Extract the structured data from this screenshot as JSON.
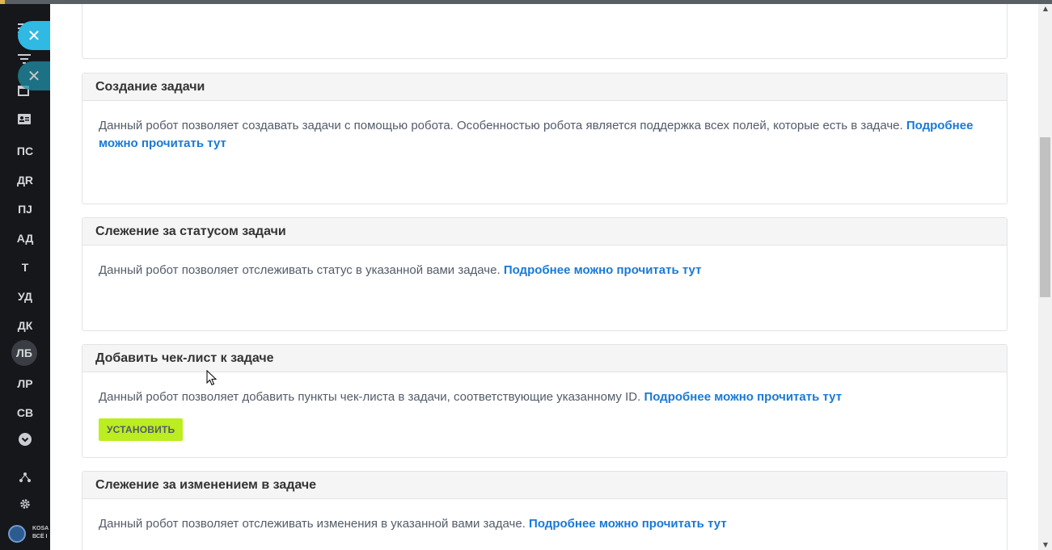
{
  "sidebar": {
    "close_icon": "✕",
    "items": [
      {
        "label": "ПС"
      },
      {
        "label": "ДR"
      },
      {
        "label": "ПJ"
      },
      {
        "label": "АД"
      },
      {
        "label": "Т"
      },
      {
        "label": "УД"
      },
      {
        "label": "ДК"
      },
      {
        "label": "ЛБ"
      },
      {
        "label": "ЛР"
      },
      {
        "label": "СВ"
      }
    ],
    "brand": {
      "line1": "KOSA",
      "line2": "ВСЁ I"
    }
  },
  "cards": [
    {
      "title": "",
      "text": "",
      "link": ""
    },
    {
      "title": "Создание задачи",
      "text": "Данный робот позволяет создавать задачи с помощью робота. Особенностью робота является поддержка всех полей, которые есть в задаче.",
      "link": "Подробнее можно прочитать тут"
    },
    {
      "title": "Слежение за статусом задачи",
      "text": "Данный робот позволяет отслеживать статус в указанной вами задаче.",
      "link": "Подробнее можно прочитать тут"
    },
    {
      "title": "Добавить чек-лист к задаче",
      "text": "Данный робот позволяет добавить пункты чек-листа в задачи, соответствующие указанному ID.",
      "link": "Подробнее можно прочитать тут",
      "button": "УСТАНОВИТЬ"
    },
    {
      "title": "Слежение за изменением в задаче",
      "text": "Данный робот позволяет отслеживать изменения в указанной вами задаче.",
      "link": "Подробнее можно прочитать тут"
    }
  ],
  "colors": {
    "sidebar_bg": "#16171b",
    "close_accent": "#2fb9e3",
    "link": "#1a79d6",
    "install_button": "#bbed21",
    "card_header_bg": "#f5f5f6"
  }
}
